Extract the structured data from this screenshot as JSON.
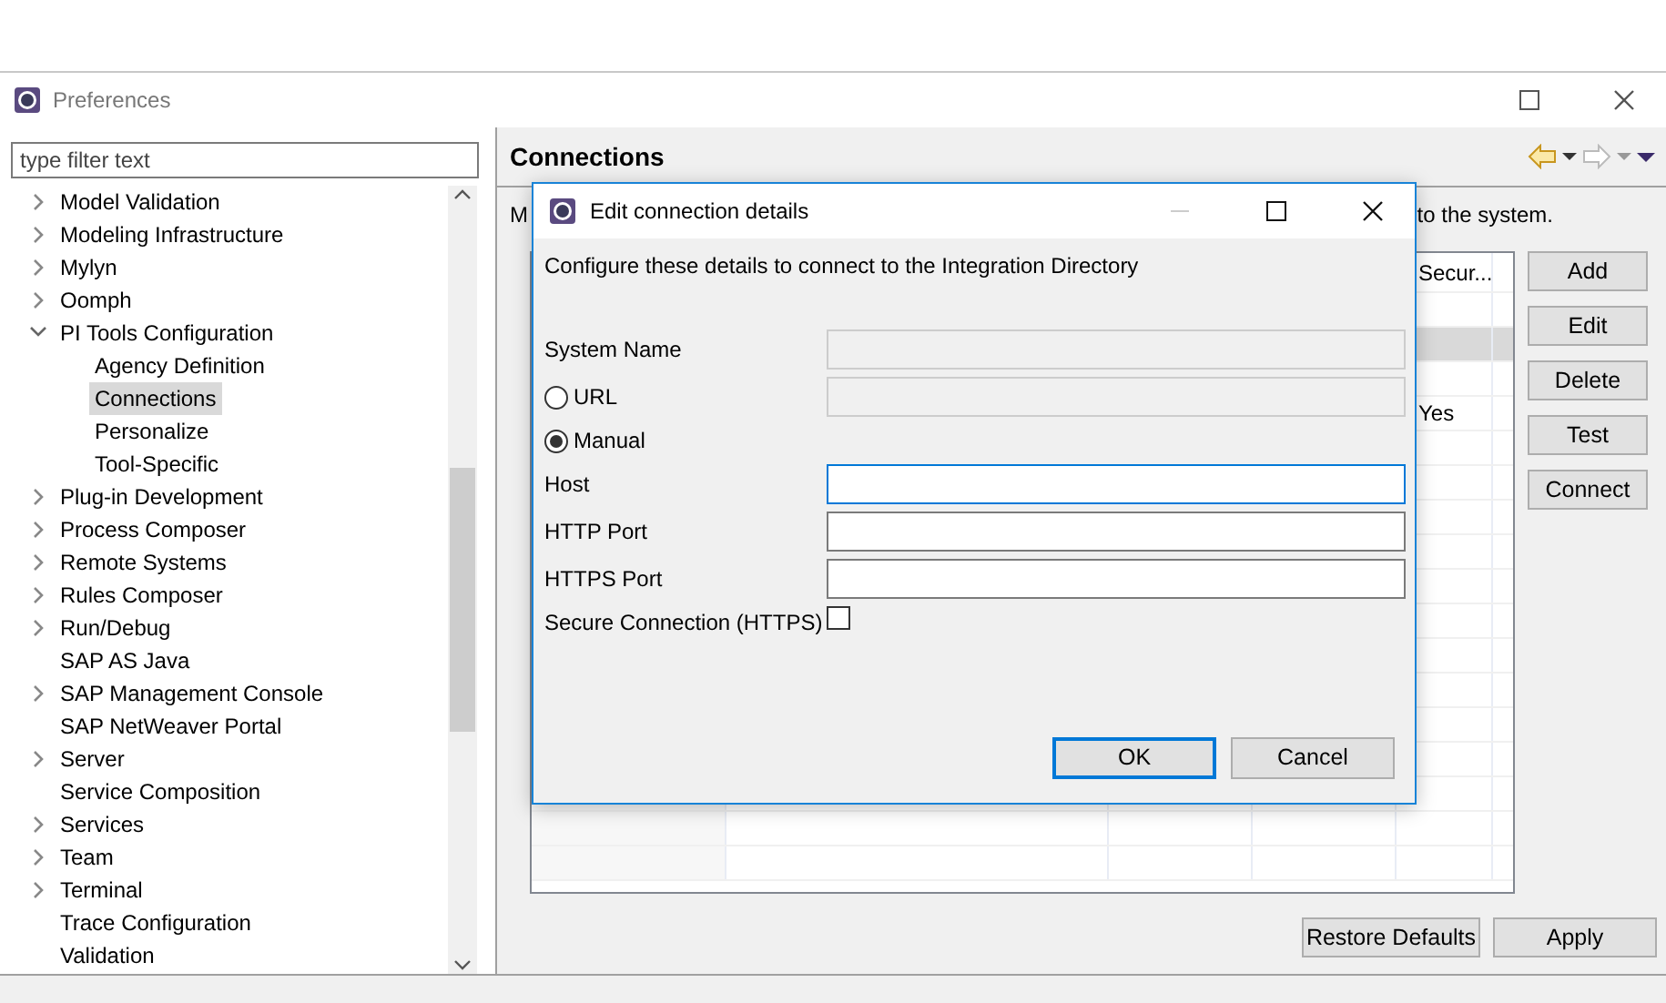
{
  "window": {
    "title": "Preferences"
  },
  "filter": {
    "placeholder": "type filter text"
  },
  "tree": [
    {
      "label": "Model Validation",
      "expandable": true,
      "expanded": false,
      "selected": false
    },
    {
      "label": "Modeling Infrastructure",
      "expandable": true,
      "expanded": false,
      "selected": false
    },
    {
      "label": "Mylyn",
      "expandable": true,
      "expanded": false,
      "selected": false
    },
    {
      "label": "Oomph",
      "expandable": true,
      "expanded": false,
      "selected": false
    },
    {
      "label": "PI Tools Configuration",
      "expandable": true,
      "expanded": true,
      "selected": false,
      "children": [
        {
          "label": "Agency Definition",
          "expandable": false,
          "selected": false
        },
        {
          "label": "Connections",
          "expandable": false,
          "selected": true
        },
        {
          "label": "Personalize",
          "expandable": false,
          "selected": false
        },
        {
          "label": "Tool-Specific",
          "expandable": false,
          "selected": false
        }
      ]
    },
    {
      "label": "Plug-in Development",
      "expandable": true,
      "expanded": false,
      "selected": false
    },
    {
      "label": "Process Composer",
      "expandable": true,
      "expanded": false,
      "selected": false
    },
    {
      "label": "Remote Systems",
      "expandable": true,
      "expanded": false,
      "selected": false
    },
    {
      "label": "Rules Composer",
      "expandable": true,
      "expanded": false,
      "selected": false
    },
    {
      "label": "Run/Debug",
      "expandable": true,
      "expanded": false,
      "selected": false
    },
    {
      "label": "SAP AS Java",
      "expandable": false,
      "selected": false
    },
    {
      "label": "SAP Management Console",
      "expandable": true,
      "expanded": false,
      "selected": false
    },
    {
      "label": "SAP NetWeaver Portal",
      "expandable": false,
      "selected": false
    },
    {
      "label": "Server",
      "expandable": true,
      "expanded": false,
      "selected": false
    },
    {
      "label": "Service Composition",
      "expandable": false,
      "selected": false
    },
    {
      "label": "Services",
      "expandable": true,
      "expanded": false,
      "selected": false
    },
    {
      "label": "Team",
      "expandable": true,
      "expanded": false,
      "selected": false
    },
    {
      "label": "Terminal",
      "expandable": true,
      "expanded": false,
      "selected": false
    },
    {
      "label": "Trace Configuration",
      "expandable": false,
      "selected": false
    },
    {
      "label": "Validation",
      "expandable": false,
      "selected": false
    }
  ],
  "page": {
    "title": "Connections",
    "description_start": "M",
    "description_end": "to the system.",
    "table": {
      "column_5": "Secur...",
      "rows": [
        {
          "selected": false
        },
        {
          "selected": true
        },
        {
          "selected": false
        },
        {
          "selected": false,
          "column_5": "Yes"
        },
        {
          "selected": false
        },
        {
          "selected": false
        },
        {
          "selected": false
        },
        {
          "selected": false
        },
        {
          "selected": false
        },
        {
          "selected": false
        },
        {
          "selected": false
        },
        {
          "selected": false
        },
        {
          "selected": false
        },
        {
          "selected": false
        },
        {
          "selected": false
        },
        {
          "selected": false
        },
        {
          "selected": false
        }
      ]
    },
    "buttons": [
      "Add",
      "Edit",
      "Delete",
      "Test",
      "Connect"
    ],
    "footer_buttons": [
      "Restore Defaults",
      "Apply"
    ]
  },
  "dialog": {
    "title": "Edit connection details",
    "intro": "Configure these details to connect to the Integration Directory",
    "fields": [
      {
        "kind": "text",
        "label": "System Name",
        "disabled": true,
        "focused": false
      },
      {
        "kind": "radio",
        "label": "URL",
        "selected": false,
        "field_disabled": true
      },
      {
        "kind": "radio",
        "label": "Manual",
        "selected": true
      },
      {
        "kind": "text",
        "label": "Host",
        "disabled": false,
        "focused": true
      },
      {
        "kind": "text",
        "label": "HTTP Port",
        "disabled": false,
        "focused": false
      },
      {
        "kind": "text",
        "label": "HTTPS Port",
        "disabled": false,
        "focused": false
      },
      {
        "kind": "checkbox",
        "label": "Secure Connection (HTTPS)",
        "checked": false
      }
    ],
    "buttons": [
      {
        "label": "OK",
        "default": true
      },
      {
        "label": "Cancel",
        "default": false
      }
    ]
  }
}
